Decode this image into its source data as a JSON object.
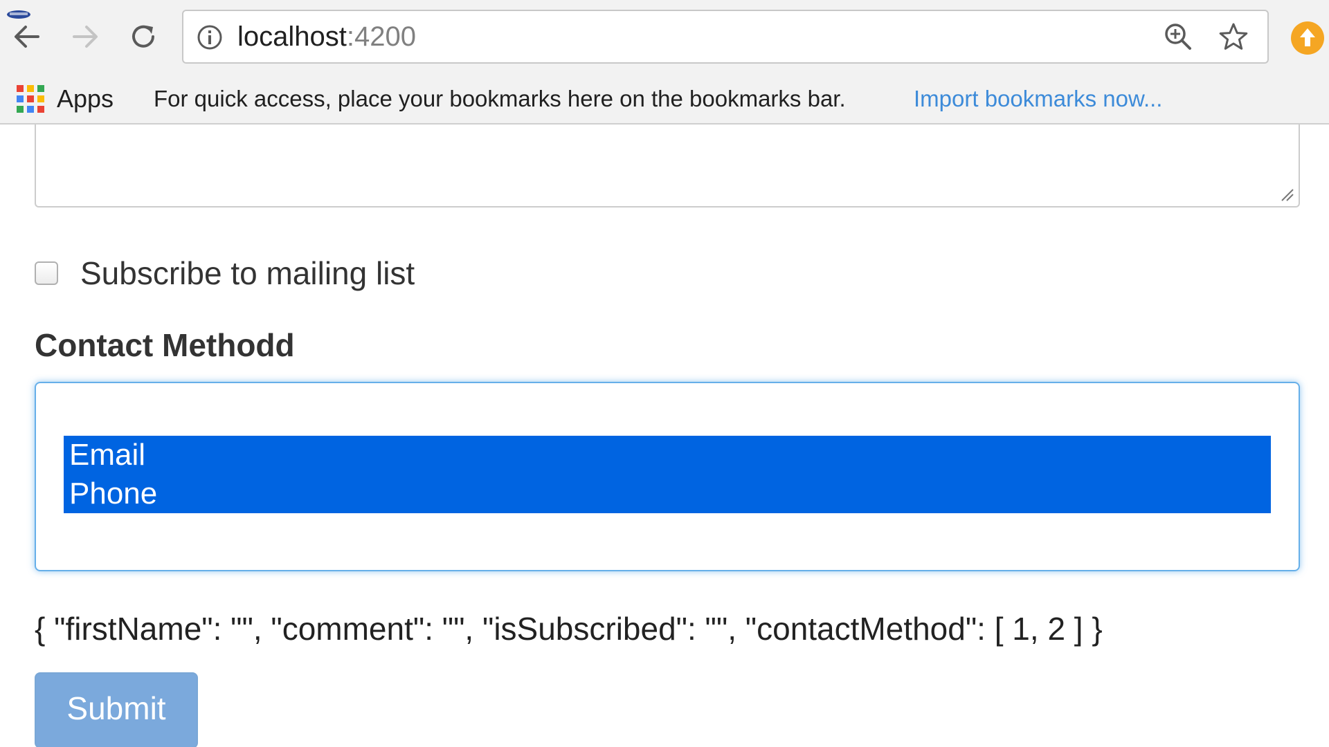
{
  "browser": {
    "url_host": "localhost",
    "url_port": ":4200",
    "bookmarks_bar": {
      "apps_label": "Apps",
      "hint": "For quick access, place your bookmarks here on the bookmarks bar.",
      "import_link": "Import bookmarks now..."
    },
    "colors": {
      "link": "#3d8bd9",
      "update_badge": "#f5a623",
      "apps_grid": [
        "#ea4335",
        "#fbbc05",
        "#34a853",
        "#4285f4",
        "#ea4335",
        "#fbbc05",
        "#34a853",
        "#4285f4",
        "#ea4335"
      ]
    },
    "icons": [
      "back-arrow-icon",
      "forward-arrow-icon",
      "reload-icon",
      "info-icon",
      "zoom-icon",
      "star-icon",
      "update-icon",
      "apps-grid-icon"
    ]
  },
  "form": {
    "comment_value": "",
    "subscribe_label": "Subscribe to mailing list",
    "subscribe_checked": false,
    "contact_label": "Contact Methodd",
    "contact_options": [
      {
        "label": "Email",
        "selected": true
      },
      {
        "label": "Phone",
        "selected": true
      }
    ],
    "model_json": "{ \"firstName\": \"\", \"comment\": \"\", \"isSubscribed\": \"\", \"contactMethod\": [ 1, 2 ] }",
    "submit_label": "Submit"
  },
  "colors": {
    "selected_option_bg": "#0064e1",
    "focus_border": "#66afe9",
    "submit_bg": "#7ba9dc"
  }
}
